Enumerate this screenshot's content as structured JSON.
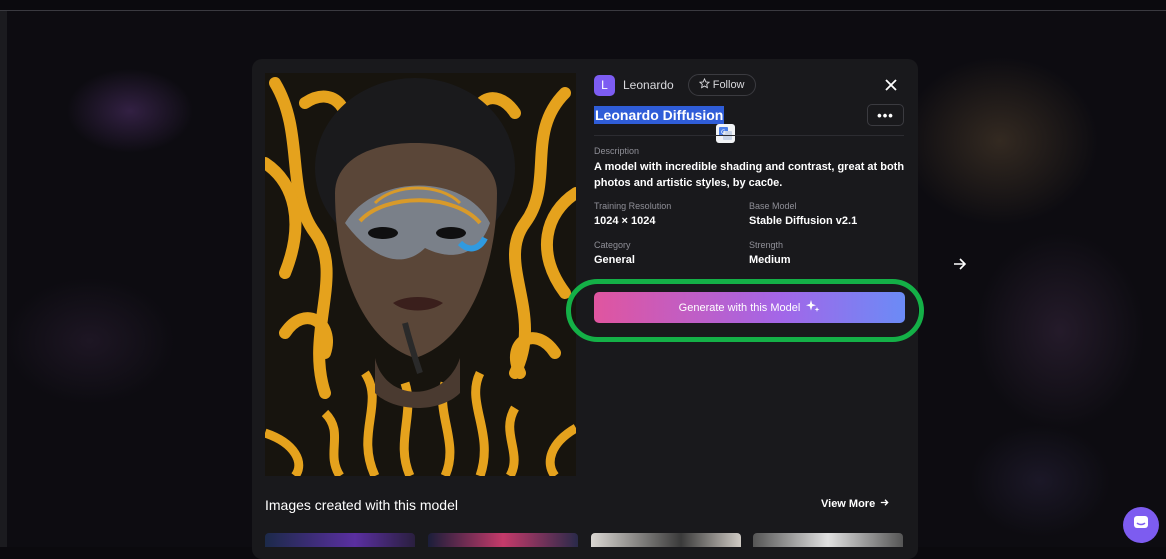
{
  "creator": {
    "avatar_letter": "L",
    "name": "Leonardo",
    "follow_label": "Follow"
  },
  "model": {
    "title": "Leonardo Diffusion",
    "description_label": "Description",
    "description": "A model with incredible shading and contrast, great at both photos and artistic styles, by cac0e.",
    "fields": {
      "training_resolution_label": "Training Resolution",
      "training_resolution": "1024 × 1024",
      "base_model_label": "Base Model",
      "base_model": "Stable Diffusion v2.1",
      "category_label": "Category",
      "category": "General",
      "strength_label": "Strength",
      "strength": "Medium"
    }
  },
  "actions": {
    "generate_label": "Generate with this Model",
    "more_label": "•••"
  },
  "gallery": {
    "title": "Images created with this model",
    "view_more_label": "View More"
  },
  "colors": {
    "accent": "#7c5cf2",
    "highlight_ring": "#14b047",
    "selection": "#2f5dd8"
  }
}
